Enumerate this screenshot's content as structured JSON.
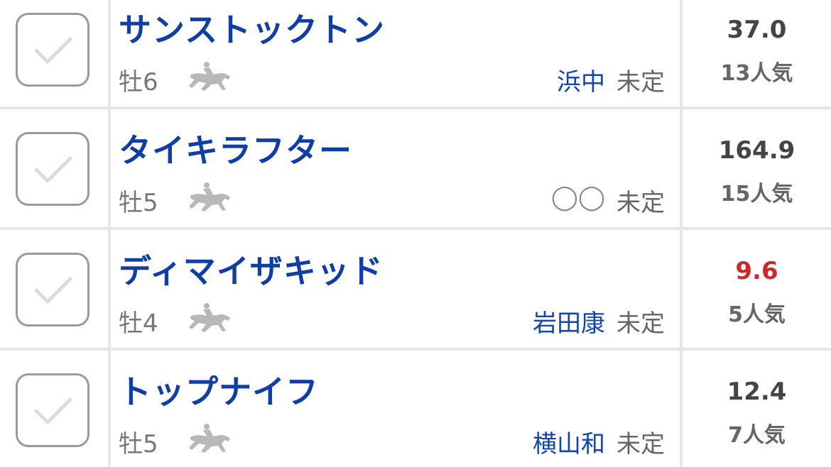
{
  "status_label": "未定",
  "entries": [
    {
      "name": "サンストックトン",
      "sex_age": "牡6",
      "jockey": "浜中",
      "odds": "37.0",
      "popularity": "13人気",
      "odds_color": "#444444"
    },
    {
      "name": "タイキラフター",
      "sex_age": "牡5",
      "jockey": "◯◯",
      "odds": "164.9",
      "popularity": "15人気",
      "odds_color": "#444444"
    },
    {
      "name": "ディマイザキッド",
      "sex_age": "牡4",
      "jockey": "岩田康",
      "odds": "9.6",
      "popularity": "5人気",
      "odds_color": "#cc2a2a"
    },
    {
      "name": "トップナイフ",
      "sex_age": "牡5",
      "jockey": "横山和",
      "odds": "12.4",
      "popularity": "7人気",
      "odds_color": "#444444"
    }
  ],
  "icons": {
    "checkbox": "check-icon",
    "horse": "racehorse-jockey-icon"
  },
  "colors": {
    "horse_name": "#0f3ea6",
    "jockey": "#1346a8",
    "divider": "#e6e6ea"
  }
}
